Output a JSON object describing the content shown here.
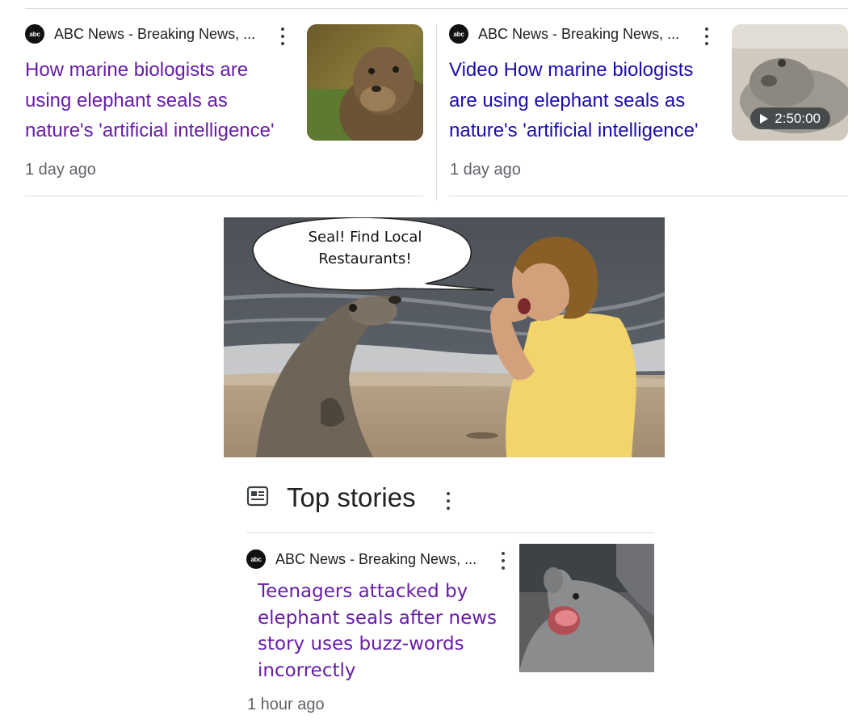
{
  "cards": [
    {
      "source": "ABC News - Breaking News, ...",
      "logo_text": "abc",
      "headline_lines": [
        "How marine biologists are",
        "using elephant seals as",
        "nature's 'artificial intelligence'"
      ],
      "time": "1 day ago",
      "link_state": "visited"
    },
    {
      "source": "ABC News - Breaking News, ...",
      "logo_text": "abc",
      "headline_lines": [
        "Video How marine biologists",
        "are using elephant seals as",
        "nature's 'artificial intelligence'"
      ],
      "time": "1 day ago",
      "video_duration": "2:50:00",
      "link_state": "unvisited"
    }
  ],
  "meme": {
    "speech_bubble_lines": [
      "Seal! Find Local",
      "Restaurants!"
    ]
  },
  "top_stories": {
    "title": "Top stories",
    "icon": "newspaper-icon",
    "item": {
      "source": "ABC News - Breaking News, ...",
      "logo_text": "abc",
      "headline_lines": [
        "Teenagers attacked by",
        "elephant seals after news",
        "story uses buzz-words",
        "incorrectly"
      ],
      "time": "1 hour ago"
    }
  },
  "colors": {
    "visited_link": "#681da8",
    "unvisited_link": "#1a0dab",
    "meta_text": "#5f6368",
    "divider": "#dadce0"
  }
}
